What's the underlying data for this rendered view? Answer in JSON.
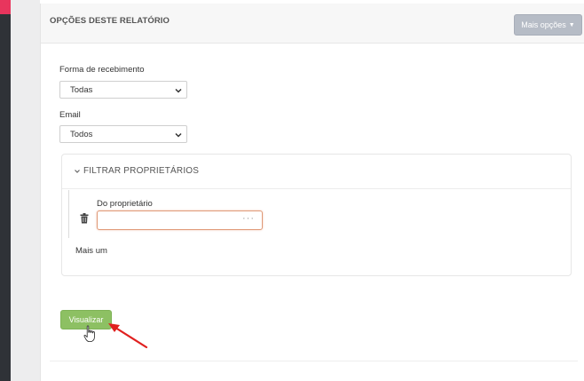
{
  "report": {
    "title": "OPÇÕES DESTE RELATÓRIO",
    "more_options_label": "Mais opções"
  },
  "fields": {
    "receipt": {
      "label": "Forma de recebimento",
      "value": "Todas"
    },
    "email": {
      "label": "Email",
      "value": "Todos"
    }
  },
  "filter": {
    "title": "FILTRAR PROPRIETÁRIOS",
    "owner_label": "Do proprietário",
    "owner_value": "",
    "lookup_dots": "···",
    "add_more_label": "Mais um"
  },
  "actions": {
    "view_label": "Visualizar"
  },
  "colors": {
    "primary_button": "#8dc063",
    "secondary_button": "#b6bcc6",
    "focus_border": "#e09a78",
    "annotation_arrow": "#e0201f",
    "sidebar_dark": "#2f3237",
    "sidebar_accent": "#e8355d"
  },
  "icons": {
    "select_caret": "chevron-down-icon",
    "filter_toggle": "chevron-down-icon",
    "remove_owner": "trash-icon",
    "pointer": "hand-cursor-icon",
    "annotation": "red-arrow-icon"
  }
}
